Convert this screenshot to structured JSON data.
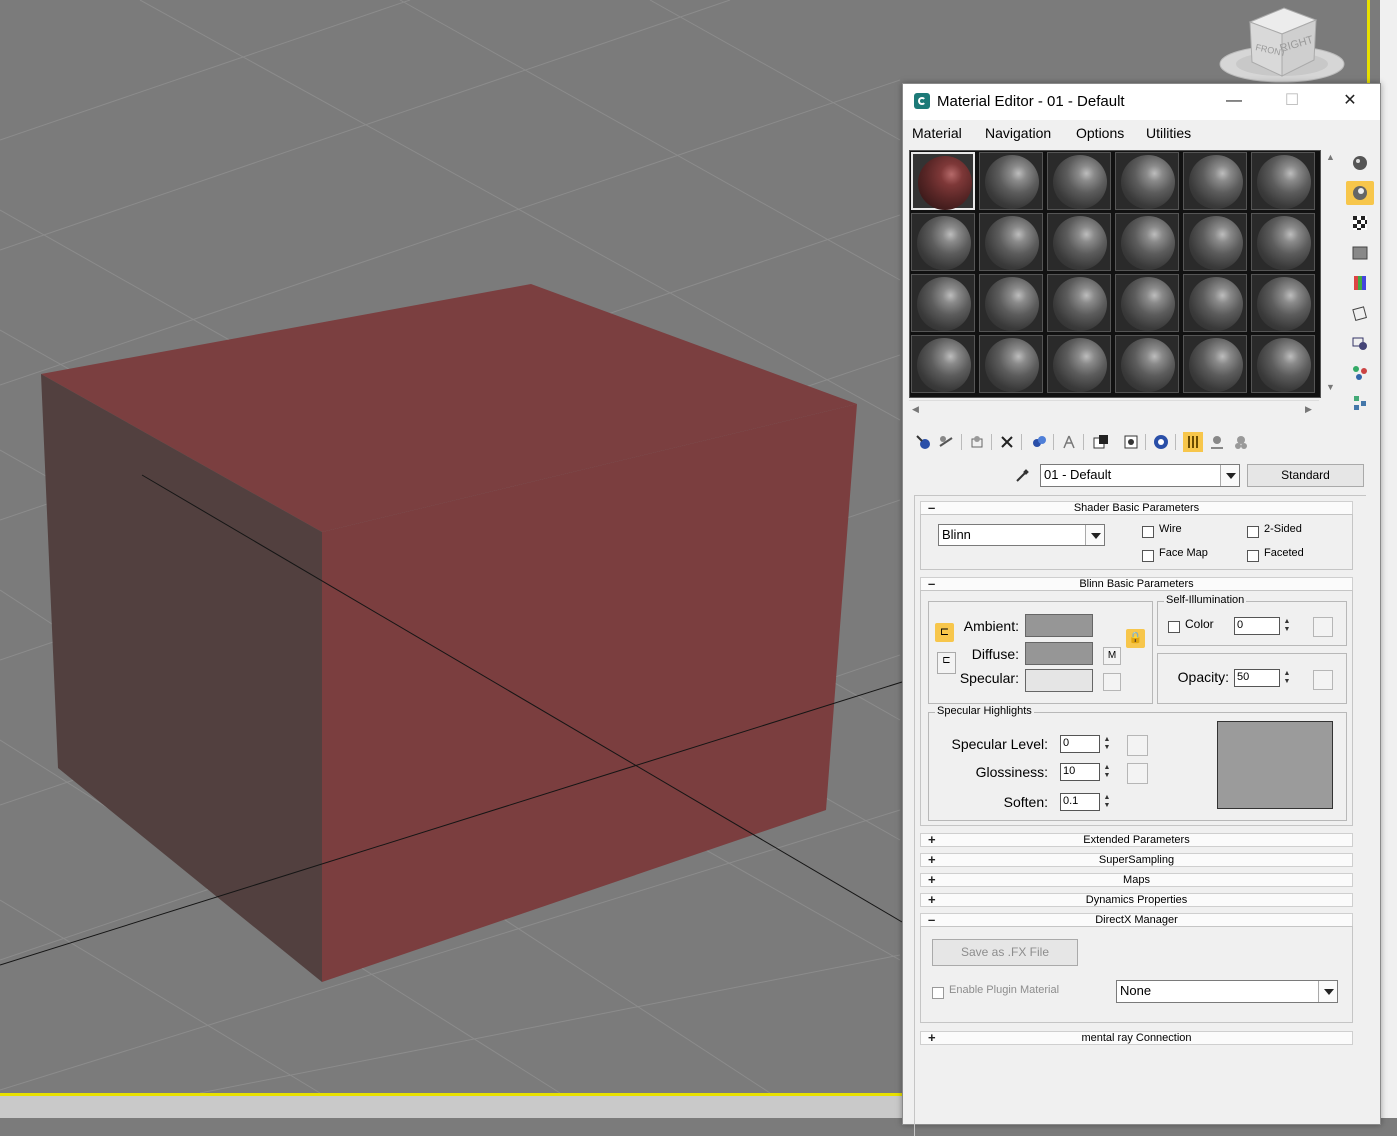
{
  "viewcube": {
    "front": "FRONT",
    "right": "RIGHT"
  },
  "window": {
    "title": "Material Editor - 01 - Default",
    "minimize": "—",
    "maximize": "☐",
    "close": "✕"
  },
  "menu": [
    "Material",
    "Navigation",
    "Options",
    "Utilities"
  ],
  "material": {
    "name": "01 - Default",
    "type": "Standard"
  },
  "shader": {
    "rollout": "Shader Basic Parameters",
    "shader_type": "Blinn",
    "wire": "Wire",
    "two_sided": "2-Sided",
    "face_map": "Face Map",
    "faceted": "Faceted"
  },
  "blinn": {
    "rollout": "Blinn Basic Parameters",
    "ambient": "Ambient:",
    "diffuse": "Diffuse:",
    "specular": "Specular:",
    "map_button": "M",
    "self_illum_title": "Self-Illumination",
    "color": "Color",
    "self_illum_value": "0",
    "opacity_label": "Opacity:",
    "opacity_value": "50",
    "colors": {
      "ambient": "#969696",
      "diffuse": "#969696",
      "specular": "#e5e5e5"
    }
  },
  "spec": {
    "title": "Specular Highlights",
    "level_label": "Specular Level:",
    "level": "0",
    "gloss_label": "Glossiness:",
    "gloss": "10",
    "soften_label": "Soften:",
    "soften": "0.1"
  },
  "rollouts": {
    "extended": "Extended Parameters",
    "supersampling": "SuperSampling",
    "maps": "Maps",
    "dynamics": "Dynamics Properties",
    "directx": "DirectX Manager",
    "mentalray": "mental ray Connection"
  },
  "directx": {
    "save_fx": "Save as .FX File",
    "enable_plugin": "Enable Plugin Material",
    "plugin_select": "None"
  },
  "rollout_signs": {
    "collapsed": "+",
    "expanded": "–"
  },
  "colors": {
    "box_front": "#7a3e3f",
    "box_side": "#51403f",
    "viewport_bg": "#7b7b7b",
    "highlight": "#f7c64b"
  }
}
